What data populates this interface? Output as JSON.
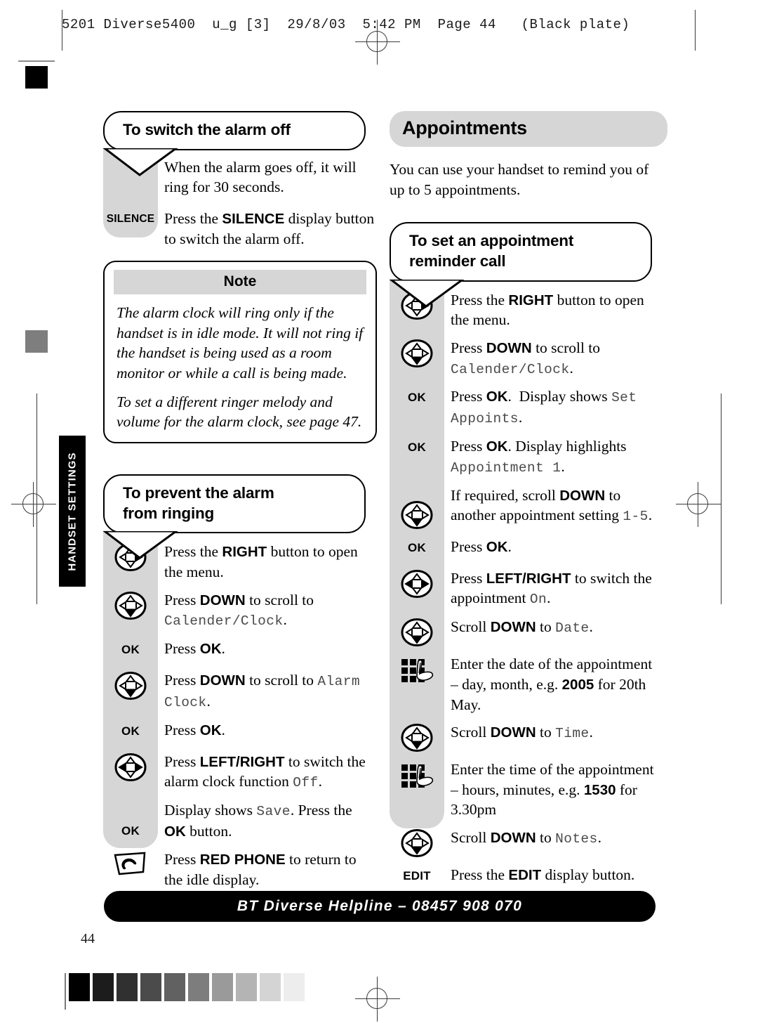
{
  "printer_marks": {
    "header_line": "5201 Diverse5400  u_g [3]  29/8/03  5:42 PM  Page 44   (Black plate)"
  },
  "side_tab": {
    "label": "HANDSET SETTINGS"
  },
  "page": {
    "number": "44"
  },
  "greyscale_strip": {
    "patches": [
      "#000000",
      "#1c1c1c",
      "#303030",
      "#4b4b4b",
      "#616161",
      "#7d7d7d",
      "#9a9a9a",
      "#b4b4b4",
      "#d4d4d4",
      "#ededed"
    ]
  },
  "left_column": {
    "section_alarm_off": {
      "title": "To switch the alarm off",
      "steps": [
        {
          "icon": "none",
          "text_html": "When the alarm goes off, it will ring for 30 seconds."
        },
        {
          "icon": "key-silence",
          "icon_label": "SILENCE",
          "text_html": "Press the <b>SILENCE</b> display button to switch the alarm off."
        }
      ]
    },
    "note": {
      "heading": "Note",
      "paragraphs": [
        "The alarm clock will ring only if the handset is in idle mode. It will not ring if the handset is being used as a room monitor or while a call is being made.",
        "To set a different ringer melody and volume for the alarm clock, see page 47."
      ]
    },
    "section_prevent_alarm": {
      "title": "To prevent the alarm from ringing",
      "steps": [
        {
          "icon": "nav-right",
          "text_html": "Press the <b>RIGHT</b> button to open the menu."
        },
        {
          "icon": "nav-down",
          "text_html": "Press <b>DOWN</b> to scroll to <span class=\"lcd\">Calender/Clock</span>."
        },
        {
          "icon": "key-ok",
          "icon_label": "OK",
          "text_html": "Press <b>OK</b>."
        },
        {
          "icon": "nav-down",
          "text_html": "Press <b>DOWN</b> to scroll to <span class=\"lcd\">Alarm Clock</span>."
        },
        {
          "icon": "key-ok",
          "icon_label": "OK",
          "text_html": "Press <b>OK</b>."
        },
        {
          "icon": "nav-leftright",
          "text_html": "Press <b>LEFT/RIGHT</b> to switch the alarm clock function <span class=\"lcd\">Off</span>."
        },
        {
          "icon": "key-ok",
          "icon_label": "OK",
          "text_html": "Display shows <span class=\"lcd\">Save</span>. Press the <b>OK</b> button."
        },
        {
          "icon": "red-phone",
          "text_html": "Press <b>RED PHONE</b> to return to the idle display."
        }
      ]
    }
  },
  "right_column": {
    "section_title": "Appointments",
    "intro": "You can use your handset to remind you of up to 5 appointments.",
    "section_set_reminder": {
      "title": "To set an appointment reminder call",
      "steps": [
        {
          "icon": "nav-right",
          "text_html": "Press the <b>RIGHT</b> button to open the menu."
        },
        {
          "icon": "nav-down",
          "text_html": "Press <b>DOWN</b> to scroll to <span class=\"lcd\">Calender/Clock</span>."
        },
        {
          "icon": "key-ok",
          "icon_label": "OK",
          "text_html": "Press <b>OK</b>.&nbsp; Display shows <span class=\"lcd\">Set Appoints</span>."
        },
        {
          "icon": "key-ok",
          "icon_label": "OK",
          "text_html": "Press <b>OK</b>. Display highlights <span class=\"lcd\">Appointment 1</span>."
        },
        {
          "icon": "nav-down",
          "text_html": "If required, scroll <b>DOWN</b> to another appointment setting <span class=\"lcd\">1-5</span>."
        },
        {
          "icon": "key-ok",
          "icon_label": "OK",
          "text_html": "Press <b>OK</b>."
        },
        {
          "icon": "nav-leftright",
          "text_html": "Press <b>LEFT/RIGHT</b> to switch the appointment <span class=\"lcd\">On</span>."
        },
        {
          "icon": "nav-down",
          "text_html": "Scroll <b>DOWN</b> to <span class=\"lcd\">Date</span>."
        },
        {
          "icon": "keypad",
          "text_html": "Enter the date of the appointment &ndash; day, month, e.g. <b>2005</b> for 20th May."
        },
        {
          "icon": "nav-down",
          "text_html": "Scroll <b>DOWN</b> to <span class=\"lcd\">Time</span>."
        },
        {
          "icon": "keypad",
          "text_html": "Enter the time of the appointment &ndash; hours, minutes, e.g. <b>1530</b> for 3.30pm"
        },
        {
          "icon": "nav-down",
          "text_html": "Scroll <b>DOWN</b> to <span class=\"lcd\">Notes</span>."
        },
        {
          "icon": "key-edit",
          "icon_label": "EDIT",
          "text_html": "Press the <b>EDIT</b> display button."
        }
      ]
    }
  },
  "footer": {
    "helpline": "BT Diverse Helpline – 08457 908 070"
  }
}
